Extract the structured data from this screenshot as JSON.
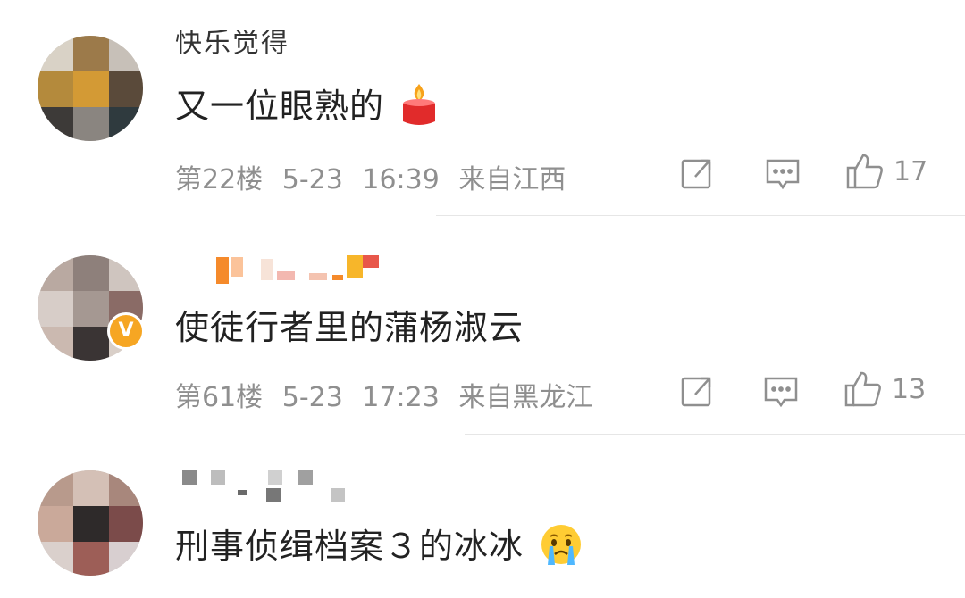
{
  "comments": [
    {
      "username": "快乐觉得",
      "text": "又一位眼熟的",
      "emoji": "candle-emoji",
      "floor": "第22楼",
      "date": "5-23",
      "time": "16:39",
      "location": "来自江西",
      "likes": "17"
    },
    {
      "username": "",
      "text": "使徒行者里的蒲杨淑云",
      "floor": "第61楼",
      "date": "5-23",
      "time": "17:23",
      "location": "来自黑龙江",
      "likes": "13",
      "verified_badge": "V"
    },
    {
      "username": "",
      "text": "刑事侦缉档案３的冰冰",
      "emoji": "crying-face-emoji"
    }
  ],
  "colors": {
    "text": "#222222",
    "meta": "#8f8f8f",
    "badge": "#f6a623",
    "divider": "#e6e6e6"
  },
  "icons": [
    "repost-icon",
    "comment-icon",
    "thumbs-up-icon"
  ]
}
